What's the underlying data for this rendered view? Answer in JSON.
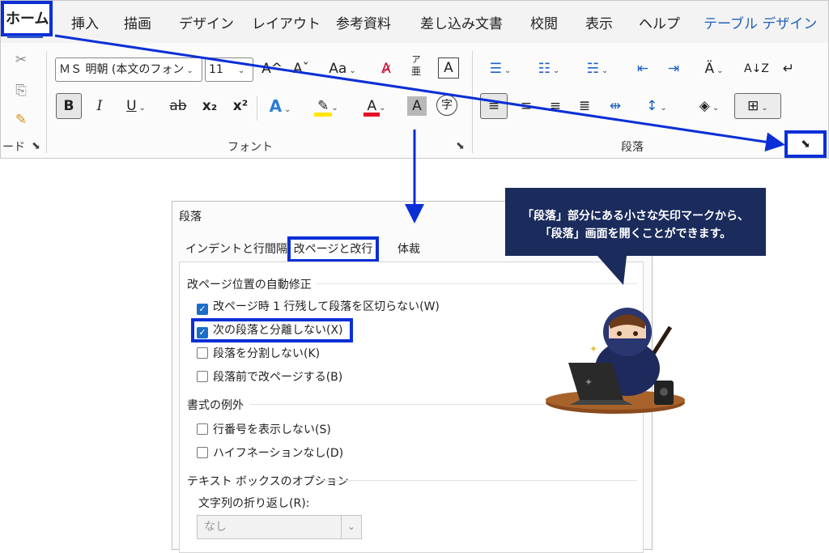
{
  "ribbon": {
    "tabs": [
      "ホーム",
      "挿入",
      "描画",
      "デザイン",
      "レイアウト",
      "参考資料",
      "差し込み文書",
      "校閲",
      "表示",
      "ヘルプ",
      "テーブル デザイン"
    ],
    "font_name": "ＭＳ 明朝 (本文のフォン",
    "font_size": "11",
    "groups": {
      "clipboard": "ード",
      "font": "フォント",
      "paragraph": "段落"
    },
    "glyphs": {
      "grow": "A^",
      "shrink": "Aˇ",
      "case": "Aa",
      "ruby_top": "ア",
      "ruby_bottom": "亜",
      "boxed": "A",
      "bold": "B",
      "italic": "I",
      "underline": "U",
      "strike": "ab",
      "sub": "x₂",
      "sup": "x²",
      "effects": "A",
      "font_color": "A",
      "shade_char": "A",
      "enclose": "字",
      "sort": "A↓Z",
      "pilcrow": "↵"
    },
    "colors": {
      "highlight": "#ffe600",
      "font_color": "#e81123",
      "text_effects": "#2b7cd3"
    }
  },
  "dialog": {
    "title": "段落",
    "tabs": [
      "インデントと行間隔",
      "改ページと改行",
      "体裁"
    ],
    "active_tab": "改ページと改行",
    "section1": "改ページ位置の自動修正",
    "checks1": [
      {
        "label": "改ページ時 1 行残して段落を区切らない(W)",
        "checked": true
      },
      {
        "label": "次の段落と分離しない(X)",
        "checked": true
      },
      {
        "label": "段落を分割しない(K)",
        "checked": false
      },
      {
        "label": "段落前で改ページする(B)",
        "checked": false
      }
    ],
    "section2": "書式の例外",
    "checks2": [
      {
        "label": "行番号を表示しない(S)",
        "checked": false
      },
      {
        "label": "ハイフネーションなし(D)",
        "checked": false
      }
    ],
    "section3": "テキスト ボックスのオプション",
    "wrap_label": "文字列の折り返し(R):",
    "wrap_value": "なし"
  },
  "callout": {
    "line1": "「段落」部分にある小さな矢印マークから、",
    "line2": "「段落」画面を開くことができます。"
  },
  "accent": "#0a2fd6"
}
